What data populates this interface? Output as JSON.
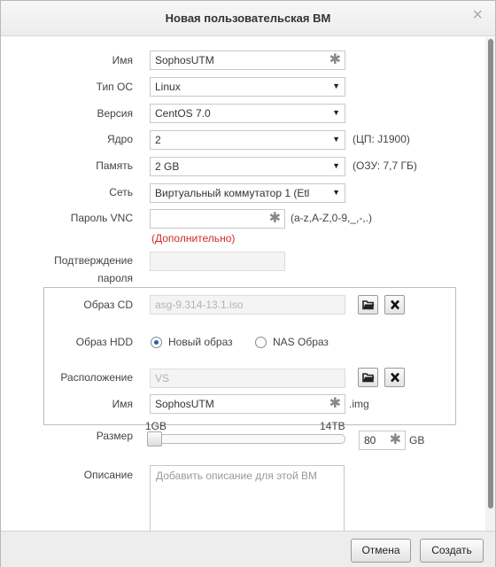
{
  "dialog": {
    "title": "Новая пользовательская ВМ",
    "close_glyph": "×"
  },
  "form": {
    "name": {
      "label": "Имя",
      "value": "SophosUTM"
    },
    "os_type": {
      "label": "Тип ОС",
      "value": "Linux"
    },
    "version": {
      "label": "Версия",
      "value": "CentOS 7.0"
    },
    "cores": {
      "label": "Ядро",
      "value": "2",
      "hint": "(ЦП: J1900)"
    },
    "memory": {
      "label": "Память",
      "value": "2 GB",
      "hint": "(ОЗУ: 7,7 ГБ)"
    },
    "network": {
      "label": "Сеть",
      "value": "Виртуальный коммутатор 1 (Etl"
    },
    "vnc_password": {
      "label": "Пароль VNC",
      "value": "",
      "hint": "(a-z,A-Z,0-9,_,-,.)",
      "advanced": "(Дополнительно)"
    },
    "confirm_password": {
      "label_line1": "Подтверждение",
      "label_line2": "пароля",
      "value": ""
    },
    "cd_image": {
      "label": "Образ CD",
      "value": "asg-9.314-13.1.iso"
    },
    "hdd": {
      "label": "Образ HDD",
      "option_new": "Новый образ",
      "option_nas": "NAS Образ",
      "selected": "new",
      "location": {
        "label": "Расположение",
        "value": "VS"
      },
      "name": {
        "label": "Имя",
        "value": "SophosUTM",
        "suffix": ".img"
      },
      "size": {
        "label": "Размер",
        "min_label": "1GB",
        "max_label": "14TB",
        "value": "80",
        "unit": "GB",
        "slider_fraction": 0.0
      }
    },
    "description": {
      "label": "Описание",
      "placeholder": "Добавить описание для этой ВМ"
    }
  },
  "footer": {
    "cancel_label": "Отмена",
    "create_label": "Создать"
  },
  "colors": {
    "required_star": "#888888",
    "advanced_link": "#d12b2b",
    "radio_selected": "#1d5fb5"
  },
  "icons": {
    "required": "asterisk-icon",
    "browse": "folder-icon",
    "clear": "close-x-icon",
    "dropdown": "chevron-down-icon"
  }
}
